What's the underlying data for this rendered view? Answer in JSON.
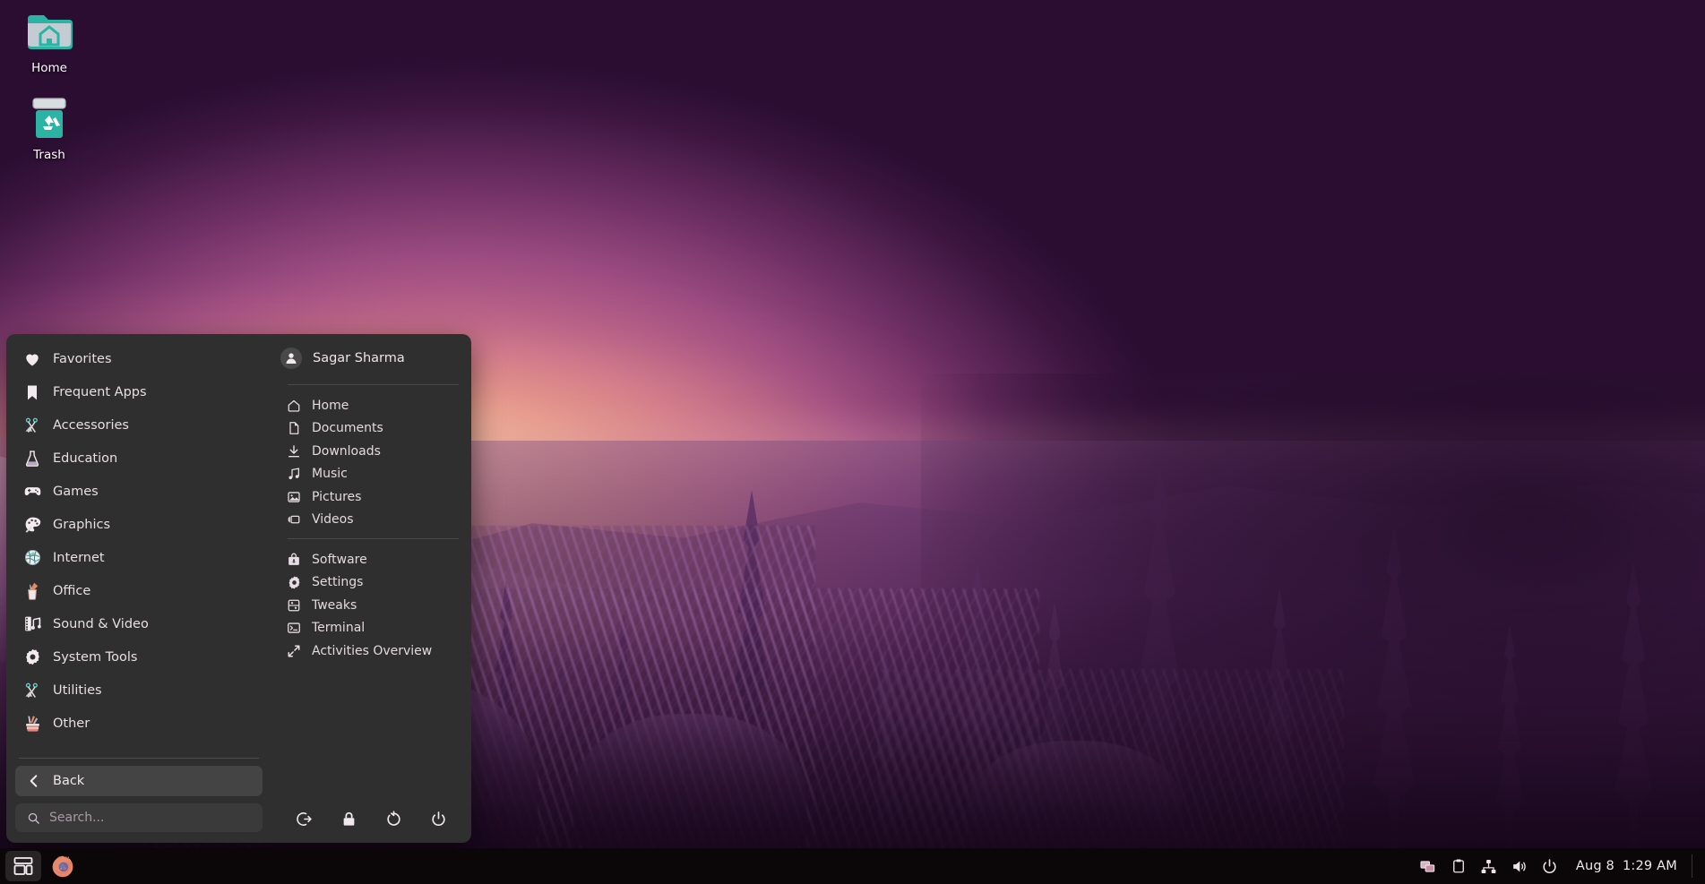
{
  "desktop": {
    "icons": [
      {
        "name": "Home",
        "icon": "home-folder-icon"
      },
      {
        "name": "Trash",
        "icon": "trash-icon"
      }
    ],
    "wallpaper_colors": {
      "sky_dark": "#250a27",
      "sky_mid": "#8c4073",
      "sky_warm": "#f6b68c",
      "snow_purple": "#6b3a6e"
    }
  },
  "menu": {
    "categories": [
      {
        "label": "Favorites",
        "icon": "heart-icon"
      },
      {
        "label": "Frequent Apps",
        "icon": "bookmark-icon"
      },
      {
        "label": "Accessories",
        "icon": "scissors-icon"
      },
      {
        "label": "Education",
        "icon": "flask-icon"
      },
      {
        "label": "Games",
        "icon": "gamepad-icon"
      },
      {
        "label": "Graphics",
        "icon": "palette-icon"
      },
      {
        "label": "Internet",
        "icon": "globe-icon"
      },
      {
        "label": "Office",
        "icon": "pencil-cup-icon"
      },
      {
        "label": "Sound & Video",
        "icon": "film-music-icon"
      },
      {
        "label": "System Tools",
        "icon": "gear-icon"
      },
      {
        "label": "Utilities",
        "icon": "scissors-icon"
      },
      {
        "label": "Other",
        "icon": "toolbox-icon"
      }
    ],
    "back_button": {
      "label": "Back",
      "icon": "chevron-left-icon"
    },
    "search": {
      "placeholder": "Search...",
      "value": "",
      "icon": "search-icon"
    },
    "user": {
      "name": "Sagar Sharma",
      "icon": "user-avatar-icon"
    },
    "places": [
      {
        "label": "Home",
        "icon": "home-icon"
      },
      {
        "label": "Documents",
        "icon": "document-icon"
      },
      {
        "label": "Downloads",
        "icon": "download-icon"
      },
      {
        "label": "Music",
        "icon": "music-note-icon"
      },
      {
        "label": "Pictures",
        "icon": "picture-icon"
      },
      {
        "label": "Videos",
        "icon": "video-camera-icon"
      }
    ],
    "system_items": [
      {
        "label": "Software",
        "icon": "software-bag-icon"
      },
      {
        "label": "Settings",
        "icon": "gear-icon"
      },
      {
        "label": "Tweaks",
        "icon": "tweaks-icon"
      },
      {
        "label": "Terminal",
        "icon": "terminal-icon"
      },
      {
        "label": "Activities Overview",
        "icon": "expand-arrows-icon"
      }
    ],
    "session_buttons": [
      {
        "name": "log-out",
        "icon": "logout-icon"
      },
      {
        "name": "lock",
        "icon": "lock-icon"
      },
      {
        "name": "restart",
        "icon": "restart-icon"
      },
      {
        "name": "power-off",
        "icon": "power-icon"
      }
    ]
  },
  "taskbar": {
    "apps": [
      {
        "name": "applications-menu",
        "icon": "window-grid-icon",
        "active": true
      },
      {
        "name": "firefox",
        "icon": "firefox-icon",
        "active": false
      }
    ],
    "tray": [
      {
        "name": "workspace-switcher",
        "icon": "windows-overlap-icon"
      },
      {
        "name": "clipboard",
        "icon": "clipboard-icon"
      },
      {
        "name": "network",
        "icon": "network-wired-icon"
      },
      {
        "name": "volume",
        "icon": "speaker-icon"
      },
      {
        "name": "power-status",
        "icon": "power-icon"
      }
    ],
    "clock": {
      "date": "Aug 8",
      "time": "1:29 AM"
    }
  }
}
